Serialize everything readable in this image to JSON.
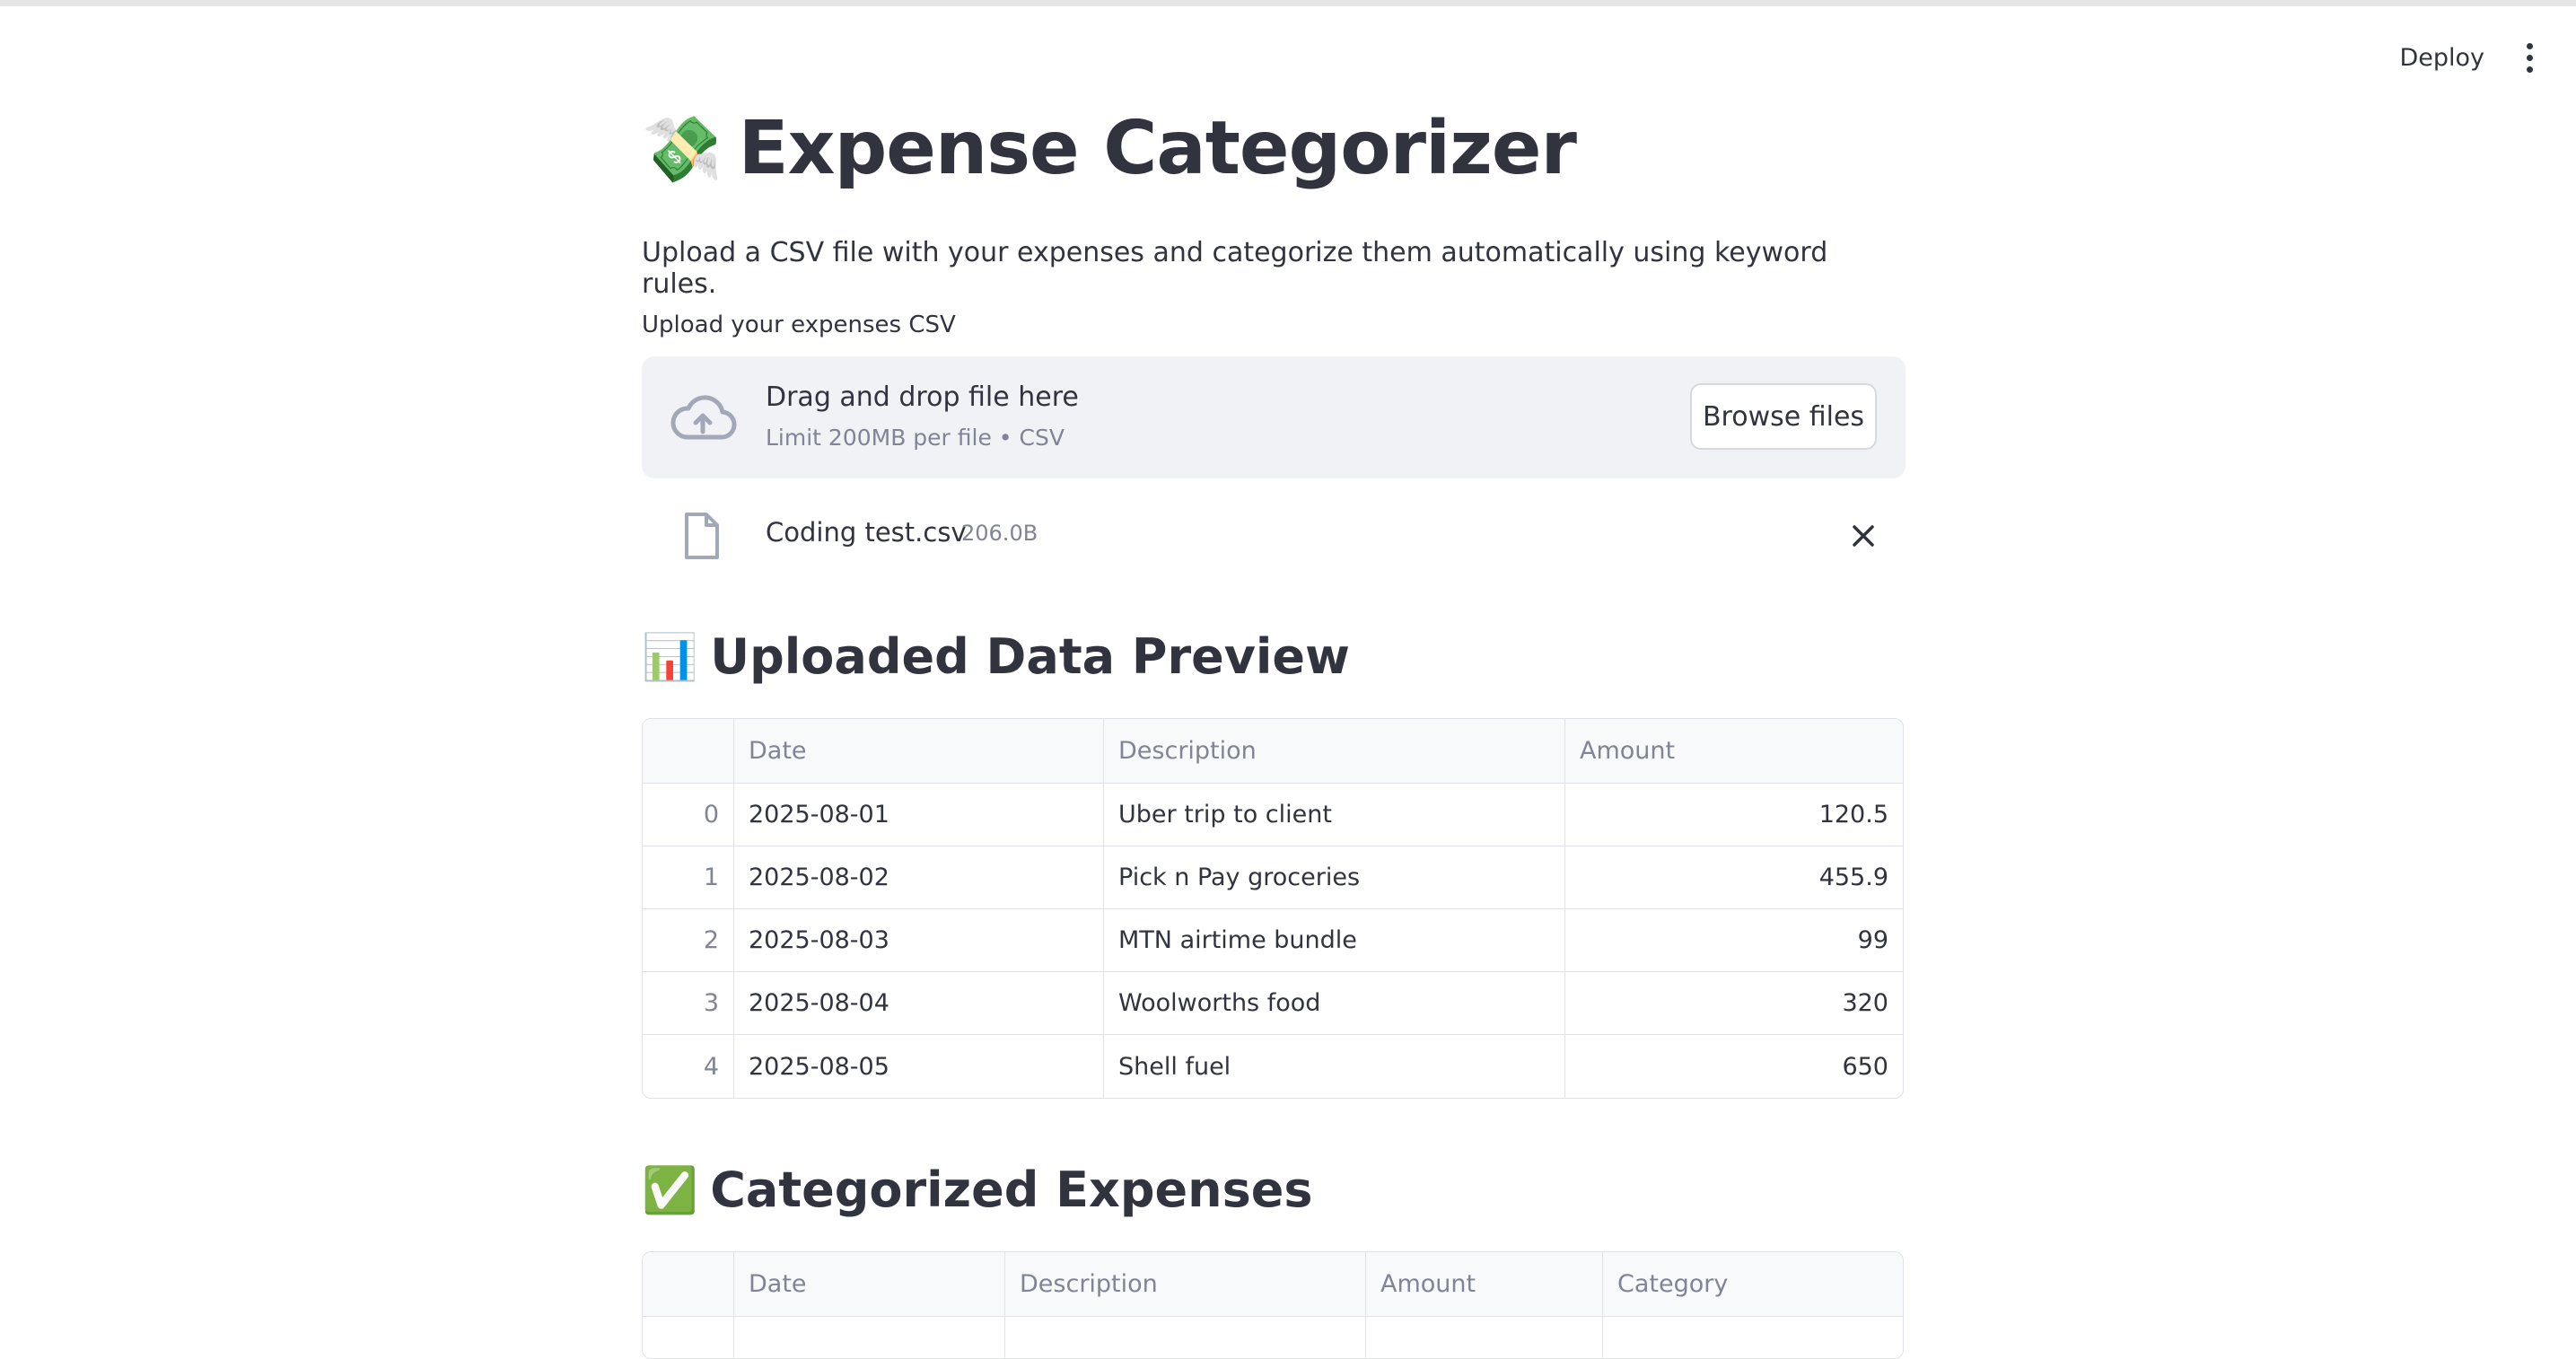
{
  "header": {
    "deploy_label": "Deploy"
  },
  "page": {
    "title": "Expense Categorizer",
    "title_emoji": "💸",
    "subtitle": "Upload a CSV file with your expenses and categorize them automatically using keyword rules."
  },
  "uploader": {
    "label": "Upload your expenses CSV",
    "drop_text": "Drag and drop file here",
    "limit_text": "Limit 200MB per file • CSV",
    "browse_label": "Browse files",
    "file_name": "Coding test.csv",
    "file_size": "206.0B"
  },
  "preview": {
    "emoji": "📊",
    "heading": "Uploaded Data Preview",
    "columns": [
      "",
      "Date",
      "Description",
      "Amount"
    ],
    "rows": [
      [
        "0",
        "2025-08-01",
        "Uber trip to client",
        "120.5"
      ],
      [
        "1",
        "2025-08-02",
        "Pick n Pay groceries",
        "455.9"
      ],
      [
        "2",
        "2025-08-03",
        "MTN airtime bundle",
        "99"
      ],
      [
        "3",
        "2025-08-04",
        "Woolworths food",
        "320"
      ],
      [
        "4",
        "2025-08-05",
        "Shell fuel",
        "650"
      ]
    ]
  },
  "categorized": {
    "emoji": "✅",
    "heading": "Categorized Expenses",
    "columns": [
      "",
      "Date",
      "Description",
      "Amount",
      "Category"
    ]
  }
}
